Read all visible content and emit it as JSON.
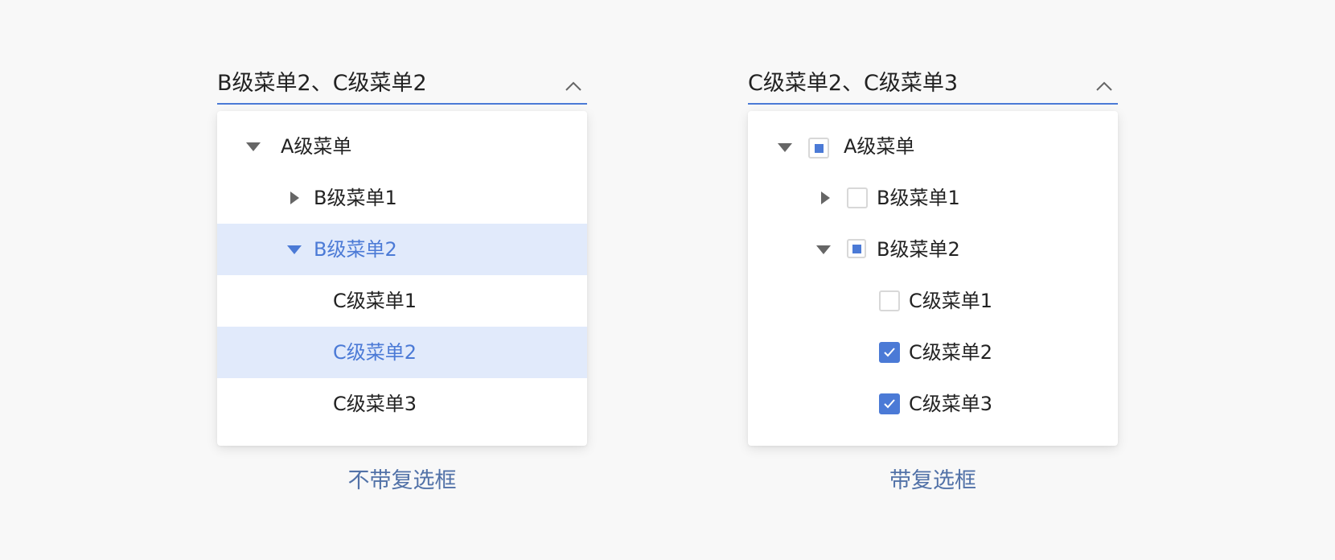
{
  "colors": {
    "accent": "#4b7ad6",
    "highlight_bg": "#e1eafb",
    "caption": "#5272a8",
    "caret": "#666666",
    "background": "#f8f8f8"
  },
  "left_demo": {
    "select_value": "B级菜单2、C级菜单2",
    "caption": "不带复选框",
    "tree": {
      "a_menu": "A级菜单",
      "b_menu1": "B级菜单1",
      "b_menu2": "B级菜单2",
      "c_menu1": "C级菜单1",
      "c_menu2": "C级菜单2",
      "c_menu3": "C级菜单3"
    }
  },
  "right_demo": {
    "select_value": "C级菜单2、C级菜单3",
    "caption": "带复选框",
    "tree": {
      "a_menu": "A级菜单",
      "b_menu1": "B级菜单1",
      "b_menu2": "B级菜单2",
      "c_menu1": "C级菜单1",
      "c_menu2": "C级菜单2",
      "c_menu3": "C级菜单3"
    },
    "check_states": {
      "a_menu": "partial",
      "b_menu1": "unchecked",
      "b_menu2": "partial",
      "c_menu1": "unchecked",
      "c_menu2": "checked",
      "c_menu3": "checked"
    }
  }
}
